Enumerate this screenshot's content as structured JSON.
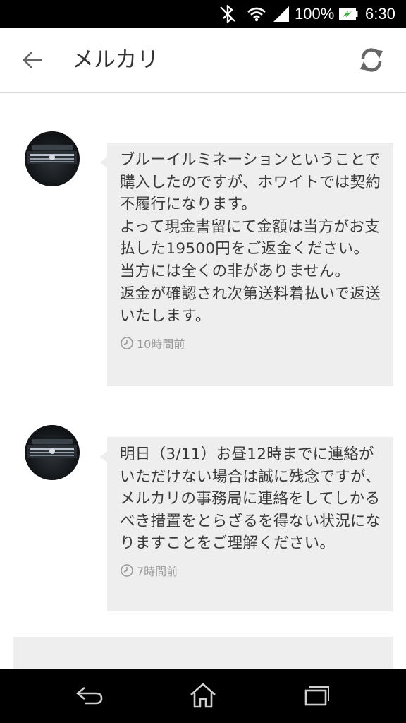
{
  "status_bar": {
    "battery_percent": "100%",
    "time": "6:30",
    "icons": [
      "bluetooth-icon",
      "wifi-icon",
      "signal-icon",
      "battery-charging-icon"
    ]
  },
  "app_bar": {
    "title": "メルカリ",
    "icons": [
      "back-arrow-icon",
      "refresh-icon"
    ]
  },
  "messages": [
    {
      "text": "ブルーイルミネーションということで購入したのですが、ホワイトでは契約不履行になります。\nよって現金書留にて金額は当方がお支払した19500円をご返金ください。\n当方には全くの非がありません。\n返金が確認され次第送料着払いで返送いたします。",
      "time": "10時間前"
    },
    {
      "text": "明日（3/11）お昼12時までに連絡がいただけない場合は誠に残念ですが、メルカリの事務局に連絡をしてしかるべき措置をとらざるを得ない状況になりますことをご理解ください。",
      "time": "7時間前"
    }
  ],
  "nav_bar": {
    "icons": [
      "back-icon",
      "home-icon",
      "recent-apps-icon"
    ]
  },
  "colors": {
    "bubble_background": "#eeeeee",
    "text": "#3a3a3a",
    "timestamp": "#9a9a9a",
    "system_bar": "#000000"
  }
}
